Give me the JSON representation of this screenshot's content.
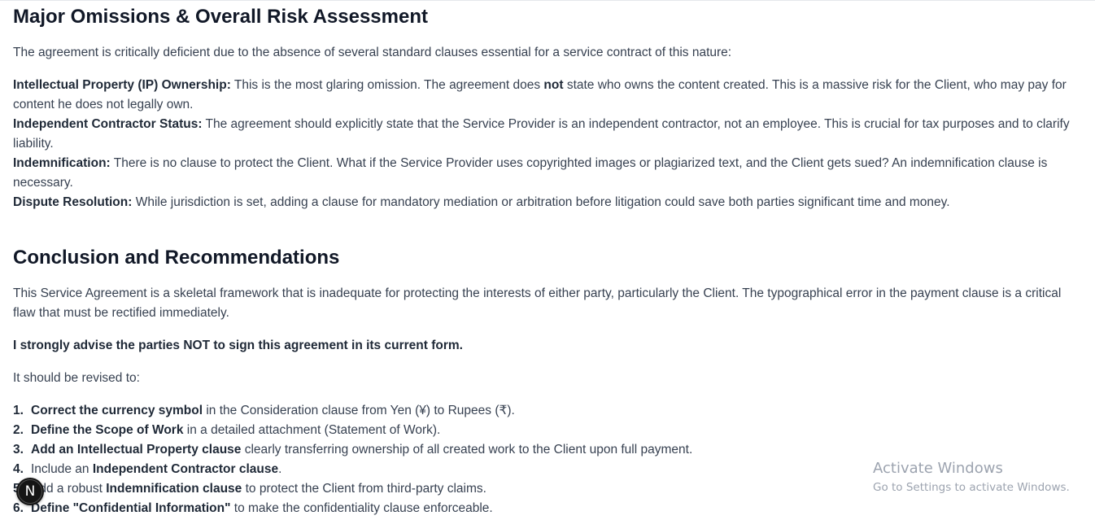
{
  "section1": {
    "heading": "Major Omissions & Overall Risk Assessment",
    "intro": "The agreement is critically deficient due to the absence of several standard clauses essential for a service contract of this nature:",
    "items": [
      {
        "term": "Intellectual Property (IP) Ownership:",
        "text_a": " This is the most glaring omission. The agreement does ",
        "emph": "not",
        "text_b": " state who owns the content created. This is a massive risk for the Client, who may pay for content he does not legally own."
      },
      {
        "term": "Independent Contractor Status:",
        "text_a": " The agreement should explicitly state that the Service Provider is an independent contractor, not an employee. This is crucial for tax purposes and to clarify liability."
      },
      {
        "term": "Indemnification:",
        "text_a": " There is no clause to protect the Client. What if the Service Provider uses copyrighted images or plagiarized text, and the Client gets sued? An indemnification clause is necessary."
      },
      {
        "term": "Dispute Resolution:",
        "text_a": " While jurisdiction is set, adding a clause for mandatory mediation or arbitration before litigation could save both parties significant time and money."
      }
    ]
  },
  "section2": {
    "heading": "Conclusion and Recommendations",
    "intro": "This Service Agreement is a skeletal framework that is inadequate for protecting the interests of either party, particularly the Client. The typographical error in the payment clause is a critical flaw that must be rectified immediately.",
    "advice": "I strongly advise the parties NOT to sign this agreement in its current form.",
    "revised_intro": "It should be revised to:",
    "list": [
      {
        "num": "1.",
        "pre": "",
        "bold": "Correct the currency symbol",
        "post": " in the Consideration clause from Yen (¥) to Rupees (₹)."
      },
      {
        "num": "2.",
        "pre": "",
        "bold": "Define the Scope of Work",
        "post": " in a detailed attachment (Statement of Work)."
      },
      {
        "num": "3.",
        "pre": "",
        "bold": "Add an Intellectual Property clause",
        "post": " clearly transferring ownership of all created work to the Client upon full payment."
      },
      {
        "num": "4.",
        "pre": "Include an ",
        "bold": "Independent Contractor clause",
        "post": "."
      },
      {
        "num": "5.",
        "pre": "Add a robust ",
        "bold": "Indemnification clause",
        "post": " to protect the Client from third-party claims."
      },
      {
        "num": "6.",
        "pre": "",
        "bold": "Define \"Confidential Information\"",
        "post": " to make the confidentiality clause enforceable."
      }
    ]
  },
  "avatar": {
    "letter": "N"
  },
  "watermark": {
    "title": "Activate Windows",
    "subtitle": "Go to Settings to activate Windows."
  }
}
